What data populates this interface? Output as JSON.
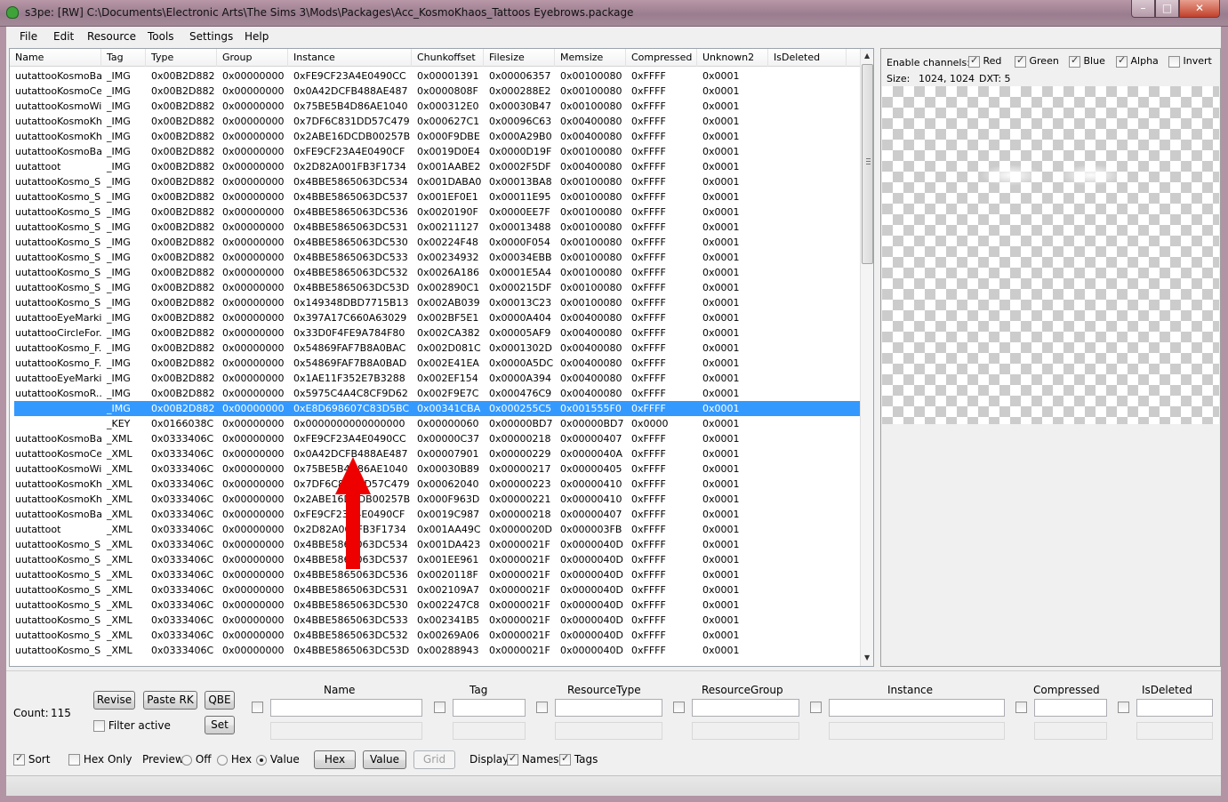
{
  "window": {
    "title": "s3pe: [RW] C:\\Documents\\Electronic Arts\\The Sims 3\\Mods\\Packages\\Acc_KosmoKhaos_Tattoos Eyebrows.package"
  },
  "menu": [
    "File",
    "Edit",
    "Resource",
    "Tools",
    "Settings",
    "Help"
  ],
  "columns": [
    "Name",
    "Tag",
    "Type",
    "Group",
    "Instance",
    "Chunkoffset",
    "Filesize",
    "Memsize",
    "Compressed",
    "Unknown2",
    "IsDeleted"
  ],
  "rows": [
    [
      "uutattooKosmoBa...",
      "_IMG",
      "0x00B2D882",
      "0x00000000",
      "0xFE9CF23A4E0490CC",
      "0x00001391",
      "0x00006357",
      "0x00100080",
      "0xFFFF",
      "0x0001"
    ],
    [
      "uutattooKosmoCe...",
      "_IMG",
      "0x00B2D882",
      "0x00000000",
      "0x0A42DCFB488AE487",
      "0x0000808F",
      "0x000288E2",
      "0x00100080",
      "0xFFFF",
      "0x0001"
    ],
    [
      "uutattooKosmoWi...",
      "_IMG",
      "0x00B2D882",
      "0x00000000",
      "0x75BE5B4D86AE1040",
      "0x000312E0",
      "0x00030B47",
      "0x00100080",
      "0xFFFF",
      "0x0001"
    ],
    [
      "uutattooKosmoKh...",
      "_IMG",
      "0x00B2D882",
      "0x00000000",
      "0x7DF6C831DD57C479",
      "0x000627C1",
      "0x00096C63",
      "0x00400080",
      "0xFFFF",
      "0x0001"
    ],
    [
      "uutattooKosmoKh...",
      "_IMG",
      "0x00B2D882",
      "0x00000000",
      "0x2ABE16DCDB00257B",
      "0x000F9DBE",
      "0x000A29B0",
      "0x00400080",
      "0xFFFF",
      "0x0001"
    ],
    [
      "uutattooKosmoBa...",
      "_IMG",
      "0x00B2D882",
      "0x00000000",
      "0xFE9CF23A4E0490CF",
      "0x0019D0E4",
      "0x0000D19F",
      "0x00100080",
      "0xFFFF",
      "0x0001"
    ],
    [
      "uutattoot",
      "_IMG",
      "0x00B2D882",
      "0x00000000",
      "0x2D82A001FB3F1734",
      "0x001AABE2",
      "0x0002F5DF",
      "0x00400080",
      "0xFFFF",
      "0x0001"
    ],
    [
      "uutattooKosmo_S...",
      "_IMG",
      "0x00B2D882",
      "0x00000000",
      "0x4BBE5865063DC534",
      "0x001DABA0",
      "0x00013BA8",
      "0x00100080",
      "0xFFFF",
      "0x0001"
    ],
    [
      "uutattooKosmo_S...",
      "_IMG",
      "0x00B2D882",
      "0x00000000",
      "0x4BBE5865063DC537",
      "0x001EF0E1",
      "0x00011E95",
      "0x00100080",
      "0xFFFF",
      "0x0001"
    ],
    [
      "uutattooKosmo_S...",
      "_IMG",
      "0x00B2D882",
      "0x00000000",
      "0x4BBE5865063DC536",
      "0x0020190F",
      "0x0000EE7F",
      "0x00100080",
      "0xFFFF",
      "0x0001"
    ],
    [
      "uutattooKosmo_S...",
      "_IMG",
      "0x00B2D882",
      "0x00000000",
      "0x4BBE5865063DC531",
      "0x00211127",
      "0x00013488",
      "0x00100080",
      "0xFFFF",
      "0x0001"
    ],
    [
      "uutattooKosmo_S...",
      "_IMG",
      "0x00B2D882",
      "0x00000000",
      "0x4BBE5865063DC530",
      "0x00224F48",
      "0x0000F054",
      "0x00100080",
      "0xFFFF",
      "0x0001"
    ],
    [
      "uutattooKosmo_S...",
      "_IMG",
      "0x00B2D882",
      "0x00000000",
      "0x4BBE5865063DC533",
      "0x00234932",
      "0x00034EBB",
      "0x00100080",
      "0xFFFF",
      "0x0001"
    ],
    [
      "uutattooKosmo_S...",
      "_IMG",
      "0x00B2D882",
      "0x00000000",
      "0x4BBE5865063DC532",
      "0x0026A186",
      "0x0001E5A4",
      "0x00100080",
      "0xFFFF",
      "0x0001"
    ],
    [
      "uutattooKosmo_S...",
      "_IMG",
      "0x00B2D882",
      "0x00000000",
      "0x4BBE5865063DC53D",
      "0x002890C1",
      "0x000215DF",
      "0x00100080",
      "0xFFFF",
      "0x0001"
    ],
    [
      "uutattooKosmo_S...",
      "_IMG",
      "0x00B2D882",
      "0x00000000",
      "0x149348DBD7715B13",
      "0x002AB039",
      "0x00013C23",
      "0x00100080",
      "0xFFFF",
      "0x0001"
    ],
    [
      "uutattooEyeMarki...",
      "_IMG",
      "0x00B2D882",
      "0x00000000",
      "0x397A17C660A63029",
      "0x002BF5E1",
      "0x0000A404",
      "0x00400080",
      "0xFFFF",
      "0x0001"
    ],
    [
      "uutattooCircleFor...",
      "_IMG",
      "0x00B2D882",
      "0x00000000",
      "0x33D0F4FE9A784F80",
      "0x002CA382",
      "0x00005AF9",
      "0x00400080",
      "0xFFFF",
      "0x0001"
    ],
    [
      "uutattooKosmo_F...",
      "_IMG",
      "0x00B2D882",
      "0x00000000",
      "0x54869FAF7B8A0BAC",
      "0x002D081C",
      "0x0001302D",
      "0x00400080",
      "0xFFFF",
      "0x0001"
    ],
    [
      "uutattooKosmo_F...",
      "_IMG",
      "0x00B2D882",
      "0x00000000",
      "0x54869FAF7B8A0BAD",
      "0x002E41EA",
      "0x0000A5DC",
      "0x00400080",
      "0xFFFF",
      "0x0001"
    ],
    [
      "uutattooEyeMarki...",
      "_IMG",
      "0x00B2D882",
      "0x00000000",
      "0x1AE11F352E7B3288",
      "0x002EF154",
      "0x0000A394",
      "0x00400080",
      "0xFFFF",
      "0x0001"
    ],
    [
      "uutattooKosmoR...",
      "_IMG",
      "0x00B2D882",
      "0x00000000",
      "0x5975C4A4C8CF9D62",
      "0x002F9E7C",
      "0x000476C9",
      "0x00400080",
      "0xFFFF",
      "0x0001"
    ],
    [
      "",
      "_IMG",
      "0x00B2D882",
      "0x00000000",
      "0xE8D698607C83D5BC",
      "0x00341CBA",
      "0x000255C5",
      "0x001555F0",
      "0xFFFF",
      "0x0001"
    ],
    [
      "",
      "_KEY",
      "0x0166038C",
      "0x00000000",
      "0x0000000000000000",
      "0x00000060",
      "0x00000BD7",
      "0x00000BD7",
      "0x0000",
      "0x0001"
    ],
    [
      "uutattooKosmoBa...",
      "_XML",
      "0x0333406C",
      "0x00000000",
      "0xFE9CF23A4E0490CC",
      "0x00000C37",
      "0x00000218",
      "0x00000407",
      "0xFFFF",
      "0x0001"
    ],
    [
      "uutattooKosmoCe...",
      "_XML",
      "0x0333406C",
      "0x00000000",
      "0x0A42DCFB488AE487",
      "0x00007901",
      "0x00000229",
      "0x0000040A",
      "0xFFFF",
      "0x0001"
    ],
    [
      "uutattooKosmoWi...",
      "_XML",
      "0x0333406C",
      "0x00000000",
      "0x75BE5B4D86AE1040",
      "0x00030B89",
      "0x00000217",
      "0x00000405",
      "0xFFFF",
      "0x0001"
    ],
    [
      "uutattooKosmoKh...",
      "_XML",
      "0x0333406C",
      "0x00000000",
      "0x7DF6C831DD57C479",
      "0x00062040",
      "0x00000223",
      "0x00000410",
      "0xFFFF",
      "0x0001"
    ],
    [
      "uutattooKosmoKh...",
      "_XML",
      "0x0333406C",
      "0x00000000",
      "0x2ABE16DCDB00257B",
      "0x000F963D",
      "0x00000221",
      "0x00000410",
      "0xFFFF",
      "0x0001"
    ],
    [
      "uutattooKosmoBa...",
      "_XML",
      "0x0333406C",
      "0x00000000",
      "0xFE9CF23A4E0490CF",
      "0x0019C987",
      "0x00000218",
      "0x00000407",
      "0xFFFF",
      "0x0001"
    ],
    [
      "uutattoot",
      "_XML",
      "0x0333406C",
      "0x00000000",
      "0x2D82A001FB3F1734",
      "0x001AA49C",
      "0x0000020D",
      "0x000003FB",
      "0xFFFF",
      "0x0001"
    ],
    [
      "uutattooKosmo_S...",
      "_XML",
      "0x0333406C",
      "0x00000000",
      "0x4BBE5865063DC534",
      "0x001DA423",
      "0x0000021F",
      "0x0000040D",
      "0xFFFF",
      "0x0001"
    ],
    [
      "uutattooKosmo_S...",
      "_XML",
      "0x0333406C",
      "0x00000000",
      "0x4BBE5865063DC537",
      "0x001EE961",
      "0x0000021F",
      "0x0000040D",
      "0xFFFF",
      "0x0001"
    ],
    [
      "uutattooKosmo_S...",
      "_XML",
      "0x0333406C",
      "0x00000000",
      "0x4BBE5865063DC536",
      "0x0020118F",
      "0x0000021F",
      "0x0000040D",
      "0xFFFF",
      "0x0001"
    ],
    [
      "uutattooKosmo_S...",
      "_XML",
      "0x0333406C",
      "0x00000000",
      "0x4BBE5865063DC531",
      "0x002109A7",
      "0x0000021F",
      "0x0000040D",
      "0xFFFF",
      "0x0001"
    ],
    [
      "uutattooKosmo_S...",
      "_XML",
      "0x0333406C",
      "0x00000000",
      "0x4BBE5865063DC530",
      "0x002247C8",
      "0x0000021F",
      "0x0000040D",
      "0xFFFF",
      "0x0001"
    ],
    [
      "uutattooKosmo_S...",
      "_XML",
      "0x0333406C",
      "0x00000000",
      "0x4BBE5865063DC533",
      "0x002341B5",
      "0x0000021F",
      "0x0000040D",
      "0xFFFF",
      "0x0001"
    ],
    [
      "uutattooKosmo_S...",
      "_XML",
      "0x0333406C",
      "0x00000000",
      "0x4BBE5865063DC532",
      "0x00269A06",
      "0x0000021F",
      "0x0000040D",
      "0xFFFF",
      "0x0001"
    ],
    [
      "uutattooKosmo_S...",
      "_XML",
      "0x0333406C",
      "0x00000000",
      "0x4BBE5865063DC53D",
      "0x00288943",
      "0x0000021F",
      "0x0000040D",
      "0xFFFF",
      "0x0001"
    ]
  ],
  "selected_row": 22,
  "preview": {
    "enable_channels_label": "Enable channels:",
    "channels": [
      {
        "label": "Red",
        "checked": true
      },
      {
        "label": "Green",
        "checked": true
      },
      {
        "label": "Blue",
        "checked": true
      },
      {
        "label": "Alpha",
        "checked": true
      },
      {
        "label": "Invert",
        "checked": false
      }
    ],
    "size_label": "Size:",
    "size_value": "1024, 1024",
    "dxt_label": "DXT: 5"
  },
  "bottom": {
    "count_label": "Count:",
    "count_value": "115",
    "revise": "Revise",
    "paste_rk": "Paste RK",
    "qbe": "QBE",
    "set": "Set",
    "filter_active": "Filter active",
    "filter_headers": [
      "Name",
      "Tag",
      "ResourceType",
      "ResourceGroup",
      "Instance",
      "Compressed",
      "IsDeleted"
    ],
    "sort": "Sort",
    "hex_only": "Hex Only",
    "preview_label": "Preview:",
    "off": "Off",
    "hex": "Hex",
    "value": "Value",
    "hex_btn": "Hex",
    "value_btn": "Value",
    "grid_btn": "Grid",
    "display_label": "Display:",
    "names": "Names",
    "tags": "Tags"
  },
  "accent": {
    "selection": "#3399ff",
    "arrow": "#ee0000"
  }
}
